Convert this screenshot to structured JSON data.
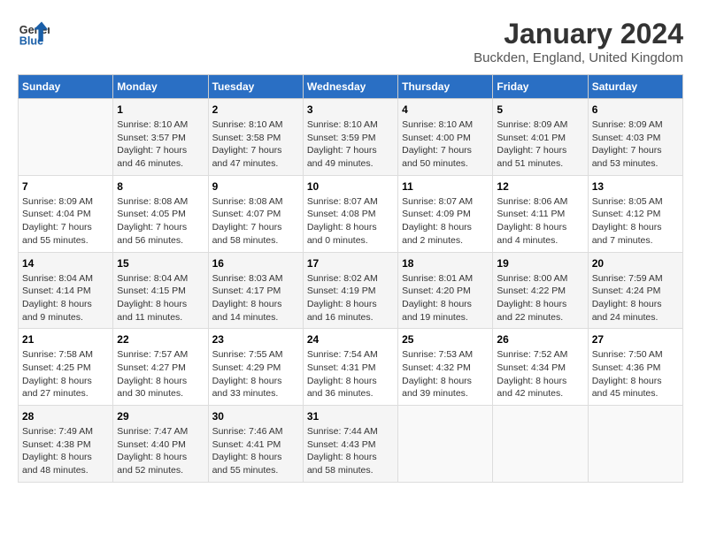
{
  "header": {
    "logo_line1": "General",
    "logo_line2": "Blue",
    "month": "January 2024",
    "location": "Buckden, England, United Kingdom"
  },
  "weekdays": [
    "Sunday",
    "Monday",
    "Tuesday",
    "Wednesday",
    "Thursday",
    "Friday",
    "Saturday"
  ],
  "weeks": [
    [
      {
        "day": "",
        "sunrise": "",
        "sunset": "",
        "daylight": ""
      },
      {
        "day": "1",
        "sunrise": "Sunrise: 8:10 AM",
        "sunset": "Sunset: 3:57 PM",
        "daylight": "Daylight: 7 hours and 46 minutes."
      },
      {
        "day": "2",
        "sunrise": "Sunrise: 8:10 AM",
        "sunset": "Sunset: 3:58 PM",
        "daylight": "Daylight: 7 hours and 47 minutes."
      },
      {
        "day": "3",
        "sunrise": "Sunrise: 8:10 AM",
        "sunset": "Sunset: 3:59 PM",
        "daylight": "Daylight: 7 hours and 49 minutes."
      },
      {
        "day": "4",
        "sunrise": "Sunrise: 8:10 AM",
        "sunset": "Sunset: 4:00 PM",
        "daylight": "Daylight: 7 hours and 50 minutes."
      },
      {
        "day": "5",
        "sunrise": "Sunrise: 8:09 AM",
        "sunset": "Sunset: 4:01 PM",
        "daylight": "Daylight: 7 hours and 51 minutes."
      },
      {
        "day": "6",
        "sunrise": "Sunrise: 8:09 AM",
        "sunset": "Sunset: 4:03 PM",
        "daylight": "Daylight: 7 hours and 53 minutes."
      }
    ],
    [
      {
        "day": "7",
        "sunrise": "Sunrise: 8:09 AM",
        "sunset": "Sunset: 4:04 PM",
        "daylight": "Daylight: 7 hours and 55 minutes."
      },
      {
        "day": "8",
        "sunrise": "Sunrise: 8:08 AM",
        "sunset": "Sunset: 4:05 PM",
        "daylight": "Daylight: 7 hours and 56 minutes."
      },
      {
        "day": "9",
        "sunrise": "Sunrise: 8:08 AM",
        "sunset": "Sunset: 4:07 PM",
        "daylight": "Daylight: 7 hours and 58 minutes."
      },
      {
        "day": "10",
        "sunrise": "Sunrise: 8:07 AM",
        "sunset": "Sunset: 4:08 PM",
        "daylight": "Daylight: 8 hours and 0 minutes."
      },
      {
        "day": "11",
        "sunrise": "Sunrise: 8:07 AM",
        "sunset": "Sunset: 4:09 PM",
        "daylight": "Daylight: 8 hours and 2 minutes."
      },
      {
        "day": "12",
        "sunrise": "Sunrise: 8:06 AM",
        "sunset": "Sunset: 4:11 PM",
        "daylight": "Daylight: 8 hours and 4 minutes."
      },
      {
        "day": "13",
        "sunrise": "Sunrise: 8:05 AM",
        "sunset": "Sunset: 4:12 PM",
        "daylight": "Daylight: 8 hours and 7 minutes."
      }
    ],
    [
      {
        "day": "14",
        "sunrise": "Sunrise: 8:04 AM",
        "sunset": "Sunset: 4:14 PM",
        "daylight": "Daylight: 8 hours and 9 minutes."
      },
      {
        "day": "15",
        "sunrise": "Sunrise: 8:04 AM",
        "sunset": "Sunset: 4:15 PM",
        "daylight": "Daylight: 8 hours and 11 minutes."
      },
      {
        "day": "16",
        "sunrise": "Sunrise: 8:03 AM",
        "sunset": "Sunset: 4:17 PM",
        "daylight": "Daylight: 8 hours and 14 minutes."
      },
      {
        "day": "17",
        "sunrise": "Sunrise: 8:02 AM",
        "sunset": "Sunset: 4:19 PM",
        "daylight": "Daylight: 8 hours and 16 minutes."
      },
      {
        "day": "18",
        "sunrise": "Sunrise: 8:01 AM",
        "sunset": "Sunset: 4:20 PM",
        "daylight": "Daylight: 8 hours and 19 minutes."
      },
      {
        "day": "19",
        "sunrise": "Sunrise: 8:00 AM",
        "sunset": "Sunset: 4:22 PM",
        "daylight": "Daylight: 8 hours and 22 minutes."
      },
      {
        "day": "20",
        "sunrise": "Sunrise: 7:59 AM",
        "sunset": "Sunset: 4:24 PM",
        "daylight": "Daylight: 8 hours and 24 minutes."
      }
    ],
    [
      {
        "day": "21",
        "sunrise": "Sunrise: 7:58 AM",
        "sunset": "Sunset: 4:25 PM",
        "daylight": "Daylight: 8 hours and 27 minutes."
      },
      {
        "day": "22",
        "sunrise": "Sunrise: 7:57 AM",
        "sunset": "Sunset: 4:27 PM",
        "daylight": "Daylight: 8 hours and 30 minutes."
      },
      {
        "day": "23",
        "sunrise": "Sunrise: 7:55 AM",
        "sunset": "Sunset: 4:29 PM",
        "daylight": "Daylight: 8 hours and 33 minutes."
      },
      {
        "day": "24",
        "sunrise": "Sunrise: 7:54 AM",
        "sunset": "Sunset: 4:31 PM",
        "daylight": "Daylight: 8 hours and 36 minutes."
      },
      {
        "day": "25",
        "sunrise": "Sunrise: 7:53 AM",
        "sunset": "Sunset: 4:32 PM",
        "daylight": "Daylight: 8 hours and 39 minutes."
      },
      {
        "day": "26",
        "sunrise": "Sunrise: 7:52 AM",
        "sunset": "Sunset: 4:34 PM",
        "daylight": "Daylight: 8 hours and 42 minutes."
      },
      {
        "day": "27",
        "sunrise": "Sunrise: 7:50 AM",
        "sunset": "Sunset: 4:36 PM",
        "daylight": "Daylight: 8 hours and 45 minutes."
      }
    ],
    [
      {
        "day": "28",
        "sunrise": "Sunrise: 7:49 AM",
        "sunset": "Sunset: 4:38 PM",
        "daylight": "Daylight: 8 hours and 48 minutes."
      },
      {
        "day": "29",
        "sunrise": "Sunrise: 7:47 AM",
        "sunset": "Sunset: 4:40 PM",
        "daylight": "Daylight: 8 hours and 52 minutes."
      },
      {
        "day": "30",
        "sunrise": "Sunrise: 7:46 AM",
        "sunset": "Sunset: 4:41 PM",
        "daylight": "Daylight: 8 hours and 55 minutes."
      },
      {
        "day": "31",
        "sunrise": "Sunrise: 7:44 AM",
        "sunset": "Sunset: 4:43 PM",
        "daylight": "Daylight: 8 hours and 58 minutes."
      },
      {
        "day": "",
        "sunrise": "",
        "sunset": "",
        "daylight": ""
      },
      {
        "day": "",
        "sunrise": "",
        "sunset": "",
        "daylight": ""
      },
      {
        "day": "",
        "sunrise": "",
        "sunset": "",
        "daylight": ""
      }
    ]
  ]
}
